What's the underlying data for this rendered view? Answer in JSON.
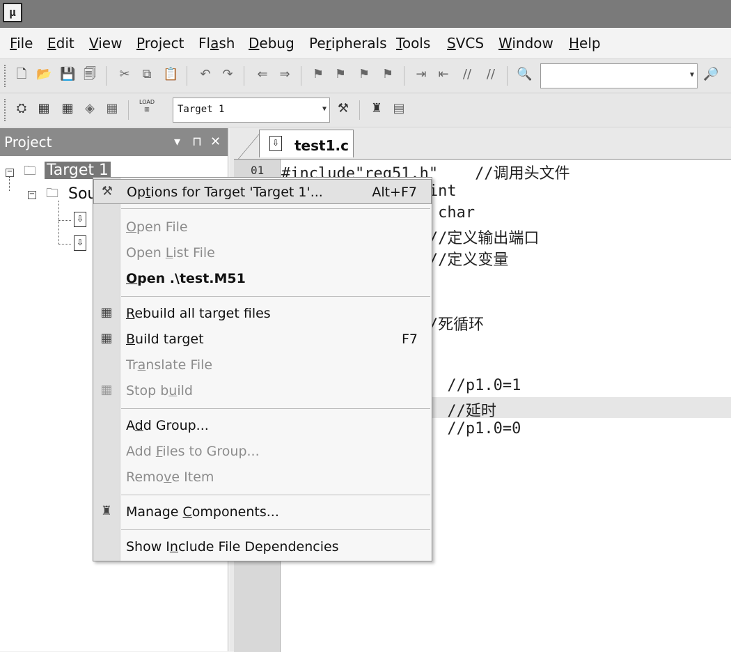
{
  "app": {
    "icon_text": "μ"
  },
  "menubar": {
    "items": [
      {
        "key": "file",
        "pre": "",
        "u": "F",
        "post": "ile"
      },
      {
        "key": "edit",
        "pre": "",
        "u": "E",
        "post": "dit"
      },
      {
        "key": "view",
        "pre": "",
        "u": "V",
        "post": "iew"
      },
      {
        "key": "project",
        "pre": "",
        "u": "P",
        "post": "roject"
      },
      {
        "key": "flash",
        "pre": "Fl",
        "u": "a",
        "post": "sh"
      },
      {
        "key": "debug",
        "pre": "",
        "u": "D",
        "post": "ebug"
      },
      {
        "key": "peripherals",
        "pre": "Pe",
        "u": "r",
        "post": "ipherals"
      },
      {
        "key": "tools",
        "pre": "",
        "u": "T",
        "post": "ools"
      },
      {
        "key": "svcs",
        "pre": "",
        "u": "S",
        "post": "VCS"
      },
      {
        "key": "window",
        "pre": "",
        "u": "W",
        "post": "indow"
      },
      {
        "key": "help",
        "pre": "",
        "u": "H",
        "post": "elp"
      }
    ]
  },
  "toolbar2": {
    "target_combo": "Target 1",
    "load_label": "LOAD"
  },
  "project_panel": {
    "title": "Project",
    "pin": "⊓",
    "close": "✕",
    "dropdown": "▾",
    "tree": {
      "target": "Target 1",
      "group": "Sou"
    }
  },
  "editor": {
    "tab": "test1.c",
    "highlight_line_index": 10,
    "lines": [
      {
        "no": "01",
        "text": "#include\"reg51.h\"    //调用头文件"
      },
      {
        "no": "",
        "text": "          igned int"
      },
      {
        "no": "",
        "text": "          signed char"
      },
      {
        "no": "",
        "text": "                //定义输出端口"
      },
      {
        "no": "",
        "text": "                //定义变量"
      },
      {
        "no": "",
        "text": ""
      },
      {
        "no": "",
        "text": ""
      },
      {
        "no": "",
        "text": "               //死循环"
      },
      {
        "no": "",
        "text": ""
      },
      {
        "no": "",
        "text": ""
      },
      {
        "no": "",
        "text": "                  //p1.0=1"
      },
      {
        "no": "",
        "text": "          i++);   //延时"
      },
      {
        "no": "",
        "text": "                  //p1.0=0"
      }
    ]
  },
  "context_menu": {
    "items": [
      {
        "id": "options",
        "pre": "Op",
        "u": "t",
        "post": "ions for Target 'Target 1'...",
        "shortcut": "Alt+F7",
        "state": "hover",
        "icon": "magic-wand-icon"
      },
      {
        "id": "open-file",
        "pre": "",
        "u": "O",
        "post": "pen File",
        "state": "disabled"
      },
      {
        "id": "open-list-file",
        "pre": "Open ",
        "u": "L",
        "post": "ist File",
        "state": "disabled"
      },
      {
        "id": "open-m51",
        "pre": "",
        "u": "O",
        "post": "pen .\\test.M51",
        "state": "bold"
      },
      {
        "id": "rebuild",
        "pre": "",
        "u": "R",
        "post": "ebuild all target files",
        "state": "normal",
        "icon": "rebuild-icon"
      },
      {
        "id": "build",
        "pre": "",
        "u": "B",
        "post": "uild target",
        "shortcut": "F7",
        "state": "normal",
        "icon": "build-icon"
      },
      {
        "id": "translate",
        "pre": "Tr",
        "u": "a",
        "post": "nslate File",
        "state": "disabled"
      },
      {
        "id": "stop-build",
        "pre": "Stop b",
        "u": "u",
        "post": "ild",
        "state": "disabled",
        "icon": "stop-build-icon"
      },
      {
        "id": "add-group",
        "pre": "A",
        "u": "d",
        "post": "d Group...",
        "state": "normal"
      },
      {
        "id": "add-files",
        "pre": "Add ",
        "u": "F",
        "post": "iles to Group...",
        "state": "disabled"
      },
      {
        "id": "remove-item",
        "pre": "Remo",
        "u": "v",
        "post": "e Item",
        "state": "disabled"
      },
      {
        "id": "manage-components",
        "pre": "Manage ",
        "u": "C",
        "post": "omponents...",
        "state": "normal",
        "icon": "components-icon"
      },
      {
        "id": "show-include",
        "pre": "Show I",
        "u": "n",
        "post": "clude File Dependencies",
        "state": "normal"
      }
    ]
  }
}
